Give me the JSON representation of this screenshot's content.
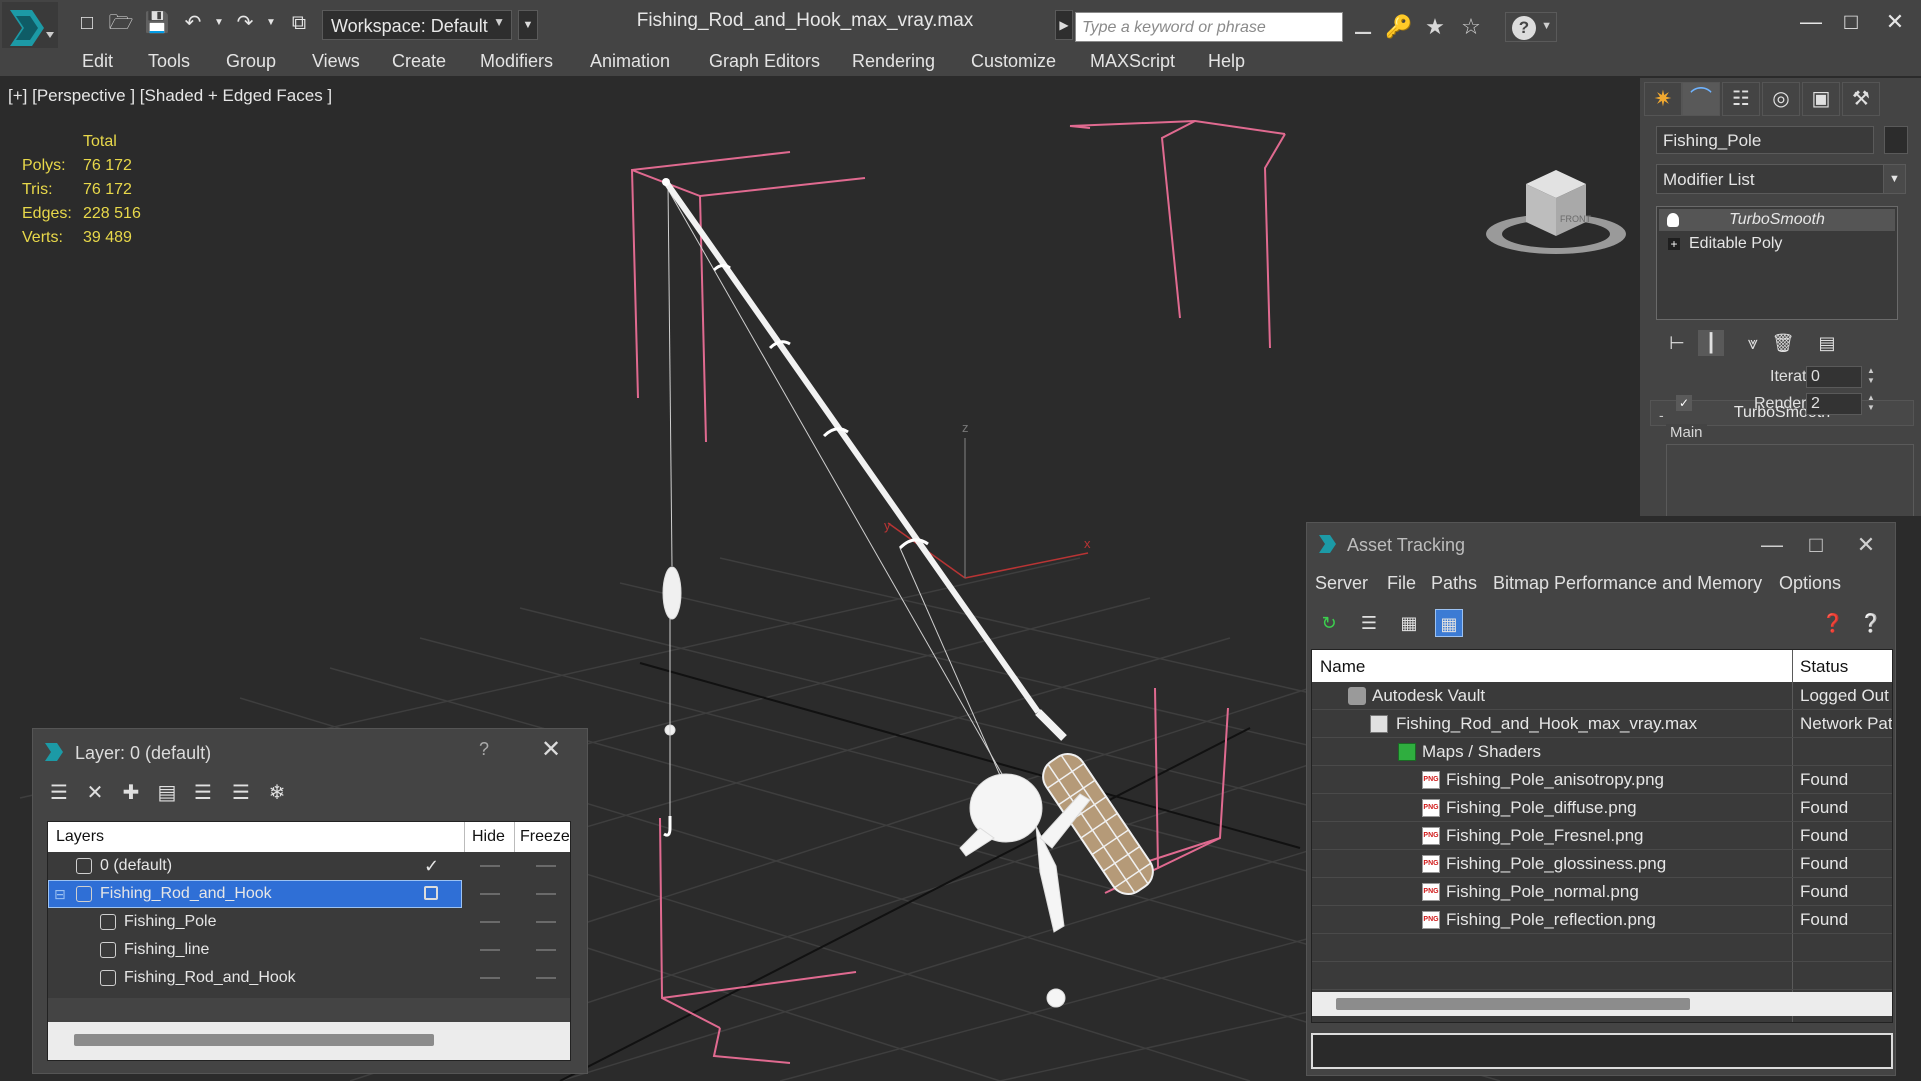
{
  "window": {
    "title": "Fishing_Rod_and_Hook_max_vray.max",
    "workspace_label": "Workspace: Default",
    "search_placeholder": "Type a keyword or phrase"
  },
  "menu": [
    "Edit",
    "Tools",
    "Group",
    "Views",
    "Create",
    "Modifiers",
    "Animation",
    "Graph Editors",
    "Rendering",
    "Customize",
    "MAXScript",
    "Help"
  ],
  "viewport": {
    "label": "[+] [Perspective ] [Shaded + Edged Faces ]",
    "stats": {
      "header": "Total",
      "rows": [
        {
          "label": "Polys:",
          "value": "76 172"
        },
        {
          "label": "Tris:",
          "value": "76 172"
        },
        {
          "label": "Edges:",
          "value": "228 516"
        },
        {
          "label": "Verts:",
          "value": "39 489"
        }
      ]
    },
    "axis_labels": {
      "x": "x",
      "y": "y",
      "z": "z"
    },
    "viewcube_label": "FRONT"
  },
  "command_panel": {
    "object_name": "Fishing_Pole",
    "modifier_list_label": "Modifier List",
    "stack": [
      "TurboSmooth",
      "Editable Poly"
    ],
    "rollout_title": "TurboSmooth",
    "rollout_minus": "-",
    "group_label": "Main",
    "iterations_label": "Iterations:",
    "iterations_value": "0",
    "render_iters_label": "Render Iters:",
    "render_iters_value": "2",
    "render_iters_checked": true
  },
  "layer_dialog": {
    "title": "Layer: 0 (default)",
    "help": "?",
    "columns": {
      "layers": "Layers",
      "hide": "Hide",
      "freeze": "Freeze"
    },
    "rows": [
      {
        "name": "0 (default)",
        "level": 0,
        "active": true,
        "selected": false
      },
      {
        "name": "Fishing_Rod_and_Hook",
        "level": 0,
        "active": false,
        "selected": true
      },
      {
        "name": "Fishing_Pole",
        "level": 1,
        "active": false,
        "selected": false
      },
      {
        "name": "Fishing_line",
        "level": 1,
        "active": false,
        "selected": false
      },
      {
        "name": "Fishing_Rod_and_Hook",
        "level": 1,
        "active": false,
        "selected": false
      }
    ]
  },
  "asset_tracking": {
    "title": "Asset Tracking",
    "menu": [
      "Server",
      "File",
      "Paths",
      "Bitmap Performance and Memory",
      "Options"
    ],
    "columns": {
      "name": "Name",
      "status": "Status"
    },
    "rows": [
      {
        "name": "Autodesk Vault",
        "status": "Logged Out",
        "level": 0,
        "icon": "vault-icon"
      },
      {
        "name": "Fishing_Rod_and_Hook_max_vray.max",
        "status": "Network Pat",
        "level": 1,
        "icon": "max-file-icon"
      },
      {
        "name": "Maps / Shaders",
        "status": "",
        "level": 2,
        "icon": "maps-icon"
      },
      {
        "name": "Fishing_Pole_anisotropy.png",
        "status": "Found",
        "level": 3,
        "icon": "png-icon"
      },
      {
        "name": "Fishing_Pole_diffuse.png",
        "status": "Found",
        "level": 3,
        "icon": "png-icon"
      },
      {
        "name": "Fishing_Pole_Fresnel.png",
        "status": "Found",
        "level": 3,
        "icon": "png-icon"
      },
      {
        "name": "Fishing_Pole_glossiness.png",
        "status": "Found",
        "level": 3,
        "icon": "png-icon"
      },
      {
        "name": "Fishing_Pole_normal.png",
        "status": "Found",
        "level": 3,
        "icon": "png-icon"
      },
      {
        "name": "Fishing_Pole_reflection.png",
        "status": "Found",
        "level": 3,
        "icon": "png-icon"
      }
    ],
    "png_badge": "PNG"
  },
  "colors": {
    "stats_yellow": "#e8d84a",
    "selection_blue": "#2f6fd6",
    "bbox_pink": "#e06a90",
    "grid": "#3a3a3a"
  }
}
